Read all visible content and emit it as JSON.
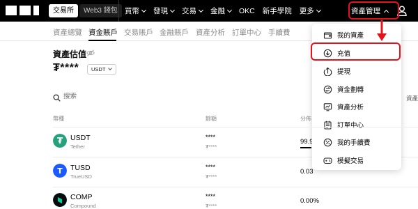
{
  "topnav": {
    "exchange_tab": "交易所",
    "wallet_tab": "Web3 錢包",
    "items": [
      {
        "label": "買幣",
        "caret": true
      },
      {
        "label": "發現",
        "caret": true
      },
      {
        "label": "交易",
        "caret": true
      },
      {
        "label": "金融",
        "caret": true
      },
      {
        "label": "OKC",
        "caret": false
      },
      {
        "label": "新手學院",
        "caret": false
      },
      {
        "label": "更多",
        "caret": true
      }
    ],
    "asset_management": "資產管理"
  },
  "subtabs": [
    "資產總覽",
    "資金賬戶",
    "交易賬戶",
    "金融賬戶",
    "資產分析",
    "訂單中心",
    "手續費"
  ],
  "valuation": {
    "title": "資產估值",
    "amount": "₮****",
    "currency": "USDT"
  },
  "search": {
    "placeholder": "搜索",
    "right_text": "資產兌"
  },
  "table": {
    "headers": {
      "coin": "幣種",
      "balance": "餘額",
      "distribution": "分佈"
    },
    "rows": [
      {
        "symbol": "USDT",
        "name": "Tether",
        "balance": "****",
        "balance_sub": "₮****",
        "distribution": "99.9",
        "share": 0.999,
        "icon_color": "#26a17b"
      },
      {
        "symbol": "TUSD",
        "name": "TrueUSD",
        "balance": "****",
        "balance_sub": "₮****",
        "distribution": "0.03",
        "share": 0.03,
        "icon_color": "#1a5aff"
      },
      {
        "symbol": "COMP",
        "name": "Compound",
        "balance": "****",
        "balance_sub": "₮****",
        "distribution": "0.00%",
        "share": 0.0,
        "icon_color": "#070a0e"
      }
    ]
  },
  "dropdown": {
    "items": [
      {
        "label": "我的資產",
        "icon": "wallet-icon"
      },
      {
        "label": "充值",
        "icon": "deposit-icon"
      },
      {
        "label": "提現",
        "icon": "withdraw-icon"
      },
      {
        "label": "資金劃轉",
        "icon": "transfer-icon"
      },
      {
        "label": "資產分析",
        "icon": "analysis-icon"
      },
      {
        "label": "訂單中心",
        "icon": "orders-icon"
      },
      {
        "label": "我的手續費",
        "icon": "fee-icon"
      },
      {
        "label": "模擬交易",
        "icon": "demo-trading-icon"
      }
    ]
  },
  "colors": {
    "highlight": "#e3121b",
    "nav_bg": "#000000"
  }
}
